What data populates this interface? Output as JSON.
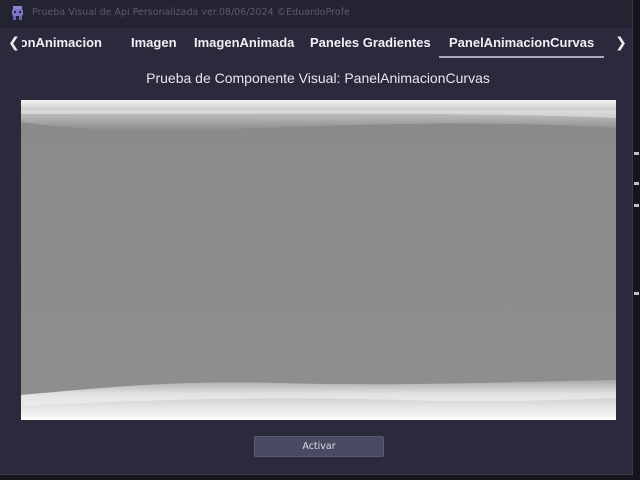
{
  "window": {
    "title": "Prueba Visual de Api Personalizada ver.08/06/2024 ©EduardoProfe",
    "app_icon": "game-controller-icon"
  },
  "tabs": {
    "scroll_left_icon": "chevron-left-icon",
    "scroll_right_icon": "chevron-right-icon",
    "scroll_left_glyph": "❮",
    "scroll_right_glyph": "❯",
    "items": [
      {
        "label": "BotonAnimacion"
      },
      {
        "label": "Imagen"
      },
      {
        "label": "ImagenAnimada"
      },
      {
        "label": "Paneles Gradientes"
      },
      {
        "label": "PanelAnimacionCurvas"
      }
    ],
    "active_index": 4
  },
  "main": {
    "heading": "Prueba de Componente Visual: PanelAnimacionCurvas",
    "activate_label": "Activar"
  },
  "colors": {
    "window_bg": "#2a2a3c",
    "titlebar_bg": "#232331",
    "panel_gray": "#868686",
    "button_bg": "#4a4a62"
  }
}
